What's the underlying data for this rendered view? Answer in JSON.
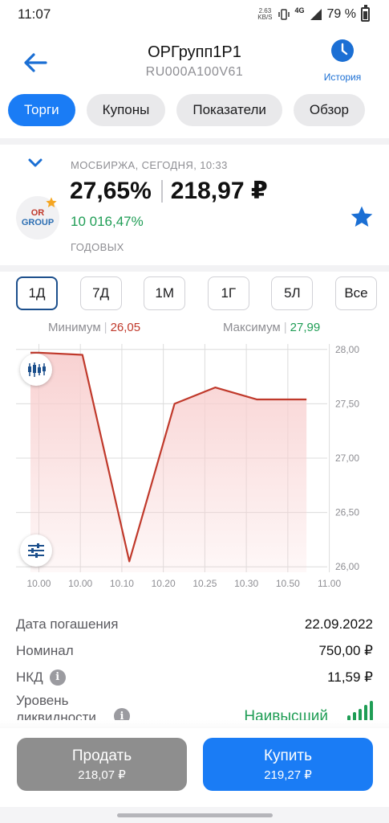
{
  "status_bar": {
    "time": "11:07",
    "net_speed_value": "2.63",
    "net_speed_unit": "KB/S",
    "network": "4G",
    "battery": "79 %"
  },
  "header": {
    "title": "ОРГрупп1Р1",
    "isin": "RU000A100V61",
    "history_label": "История"
  },
  "tabs": [
    {
      "label": "Торги",
      "active": true
    },
    {
      "label": "Купоны",
      "active": false
    },
    {
      "label": "Показатели",
      "active": false
    },
    {
      "label": "Обзор",
      "active": false
    }
  ],
  "quote": {
    "exchange_line": "МОСБИРЖА, СЕГОДНЯ, 10:33",
    "yield": "27,65%",
    "price": "218,97 ₽",
    "change": "10 016,47%",
    "annual_label": "ГОДОВЫХ",
    "logo_line1": "OR",
    "logo_line2": "GROUP"
  },
  "periods": [
    {
      "label": "1Д",
      "active": true
    },
    {
      "label": "7Д",
      "active": false
    },
    {
      "label": "1М",
      "active": false
    },
    {
      "label": "1Г",
      "active": false
    },
    {
      "label": "5Л",
      "active": false
    },
    {
      "label": "Все",
      "active": false
    }
  ],
  "range": {
    "min_label": "Минимум",
    "min_value": "26,05",
    "max_label": "Максимум",
    "max_value": "27,99"
  },
  "chart_data": {
    "type": "area",
    "x_ticks": [
      "10.00",
      "10.00",
      "10.10",
      "10.20",
      "10.25",
      "10.30",
      "10.50",
      "11.00"
    ],
    "y_ticks": [
      "28,00",
      "27,50",
      "27,00",
      "26,50",
      "26,00"
    ],
    "ylim": [
      25.95,
      28.05
    ],
    "series": [
      {
        "values": [
          {
            "x": 0.0,
            "y": 27.97
          },
          {
            "x": 1.05,
            "y": 27.95
          },
          {
            "x": 2.18,
            "y": 26.05
          },
          {
            "x": 3.27,
            "y": 27.5
          },
          {
            "x": 4.25,
            "y": 27.65
          },
          {
            "x": 5.25,
            "y": 27.54
          },
          {
            "x": 6.45,
            "y": 27.54
          }
        ]
      }
    ],
    "colors": {
      "line": "#c0392b",
      "fill": "#f8cfcf",
      "grid": "#dcdcdc"
    },
    "grid": true
  },
  "details": [
    {
      "label": "Дата погашения",
      "value": "22.09.2022",
      "info": false
    },
    {
      "label": "Номинал",
      "value": "750,00 ₽",
      "info": false
    },
    {
      "label": "НКД",
      "value": "11,59 ₽",
      "info": true
    }
  ],
  "liquidity": {
    "label_line1": "Уровень",
    "label_line2": "ликвидности",
    "value": "Наивысший",
    "level_of_five": 5
  },
  "actions": {
    "sell": {
      "label": "Продать",
      "price": "218,07 ₽"
    },
    "buy": {
      "label": "Купить",
      "price": "219,27 ₽"
    }
  },
  "colors": {
    "accent": "#1a7cf5",
    "positive": "#1f9d55",
    "negative": "#c0392b",
    "sell_button": "#8e8e8e"
  }
}
